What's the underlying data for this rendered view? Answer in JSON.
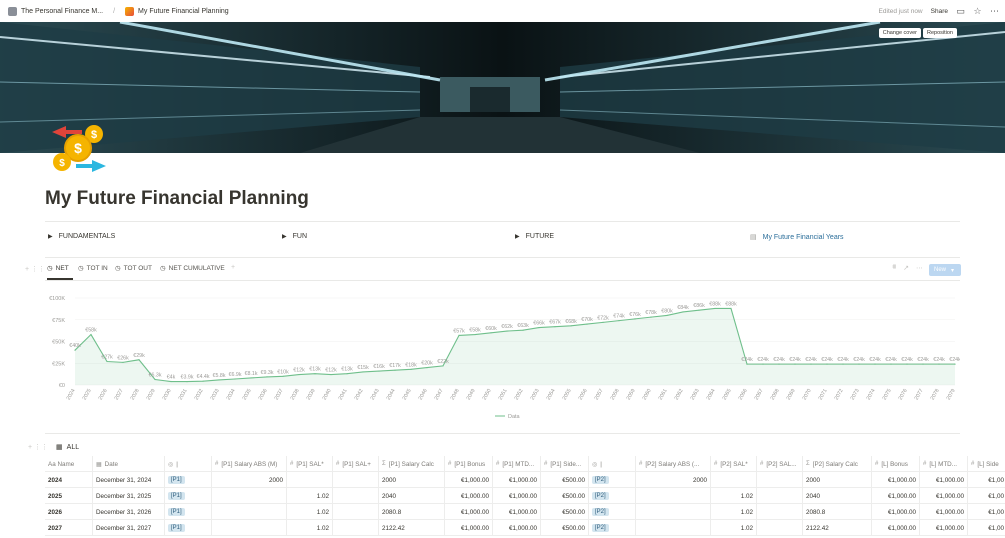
{
  "breadcrumb": {
    "parent": "The Personal Finance M...",
    "current": "My Future Financial Planning"
  },
  "topbar": {
    "edited": "Edited just now",
    "share": "Share"
  },
  "cover": {
    "change_cover": "Change cover",
    "reposition": "Reposition"
  },
  "page": {
    "title": "My Future Financial Planning"
  },
  "toggles": [
    {
      "label": "FUNDAMENTALS"
    },
    {
      "label": "FUN"
    },
    {
      "label": "FUTURE"
    },
    {
      "label": "My Future Financial Years"
    }
  ],
  "views": {
    "tabs": [
      {
        "label": "NET"
      },
      {
        "label": "TOT IN"
      },
      {
        "label": "TOT OUT"
      },
      {
        "label": "NET CUMULATIVE"
      }
    ],
    "new_label": "New"
  },
  "chart_data": {
    "type": "area",
    "legend": "Data",
    "y_ticks": [
      "€0",
      "€25K",
      "€50K",
      "€75K",
      "€100K"
    ],
    "ylim": [
      0,
      100000
    ],
    "x": [
      "2024",
      "2025",
      "2026",
      "2027",
      "2028",
      "2029",
      "2030",
      "2031",
      "2032",
      "2033",
      "2034",
      "2035",
      "2036",
      "2037",
      "2038",
      "2039",
      "2040",
      "2041",
      "2042",
      "2043",
      "2044",
      "2045",
      "2046",
      "2047",
      "2048",
      "2049",
      "2050",
      "2051",
      "2052",
      "2053",
      "2054",
      "2055",
      "2056",
      "2057",
      "2058",
      "2059",
      "2060",
      "2061",
      "2062",
      "2063",
      "2064",
      "2065",
      "2066",
      "2067",
      "2068",
      "2069",
      "2070",
      "2071",
      "2072",
      "2073",
      "2074",
      "2075",
      "2076",
      "2077",
      "2078",
      "2079"
    ],
    "values": [
      40000,
      58000,
      27000,
      26000,
      29000,
      6300,
      4000,
      3900,
      4400,
      5800,
      6900,
      8100,
      9300,
      10000,
      12000,
      13000,
      12000,
      13000,
      15000,
      16000,
      17000,
      18000,
      20000,
      22000,
      57000,
      58000,
      60000,
      62000,
      63000,
      66000,
      67000,
      68000,
      70000,
      72000,
      74000,
      76000,
      78000,
      80000,
      84000,
      86000,
      88000,
      88000,
      24000,
      24000,
      24000,
      24000,
      24000,
      24000,
      24000,
      24000,
      24000,
      24000,
      24000,
      24000,
      24000,
      24000
    ],
    "labels": [
      "€40k",
      "€58k",
      "€27k",
      "€26k",
      "€29k",
      "€6.3k",
      "€4k",
      "€3.9k",
      "€4.4k",
      "€5.8k",
      "€6.9k",
      "€8.1k",
      "€9.3k",
      "€10k",
      "€12k",
      "€13k",
      "€12k",
      "€13k",
      "€15k",
      "€16k",
      "€17k",
      "€18k",
      "€20k",
      "€22k",
      "€57k",
      "€58k",
      "€60k",
      "€62k",
      "€63k",
      "€66k",
      "€67k",
      "€68k",
      "€70k",
      "€72k",
      "€74k",
      "€76k",
      "€78k",
      "€80k",
      "€84k",
      "€86k",
      "€88k",
      "€88k",
      "€24k",
      "€24k",
      "€24k",
      "€24k",
      "€24k",
      "€24k",
      "€24k",
      "€24k",
      "€24k",
      "€24k",
      "€24k",
      "€24k",
      "€24k",
      "€24k"
    ],
    "color": "#6fbf8b"
  },
  "database": {
    "title": "ALL"
  },
  "table": {
    "headers": [
      "Aa Name",
      "Date",
      "|",
      "[P1] Salary ABS (M)",
      "[P1] SAL*",
      "[P1] SAL+",
      "[P1] Salary Calc",
      "[P1] Bonus",
      "[P1] MTD...",
      "[P1] Side...",
      "|",
      "[P2] Salary ABS (...",
      "[P2] SAL*",
      "[P2] SAL...",
      "[P2] Salary Calc",
      "[L] Bonus",
      "[L] MTD...",
      "[L] Side"
    ],
    "rows": [
      [
        "2024",
        "December 31, 2024",
        "[P1]",
        "2000",
        "",
        "",
        "2000",
        "€1,000.00",
        "€1,000.00",
        "€500.00",
        "[P2]",
        "2000",
        "",
        "",
        "2000",
        "€1,000.00",
        "€1,000.00",
        "€1,00"
      ],
      [
        "2025",
        "December 31, 2025",
        "[P1]",
        "",
        "1.02",
        "",
        "2040",
        "€1,000.00",
        "€1,000.00",
        "€500.00",
        "[P2]",
        "",
        "1.02",
        "",
        "2040",
        "€1,000.00",
        "€1,000.00",
        "€1,00"
      ],
      [
        "2026",
        "December 31, 2026",
        "[P1]",
        "",
        "1.02",
        "",
        "2080.8",
        "€1,000.00",
        "€1,000.00",
        "€500.00",
        "[P2]",
        "",
        "1.02",
        "",
        "2080.8",
        "€1,000.00",
        "€1,000.00",
        "€1,00"
      ],
      [
        "2027",
        "December 31, 2027",
        "[P1]",
        "",
        "1.02",
        "",
        "2122.42",
        "€1,000.00",
        "€1,000.00",
        "€500.00",
        "[P2]",
        "",
        "1.02",
        "",
        "2122.42",
        "€1,000.00",
        "€1,000.00",
        "€1,00"
      ]
    ]
  }
}
